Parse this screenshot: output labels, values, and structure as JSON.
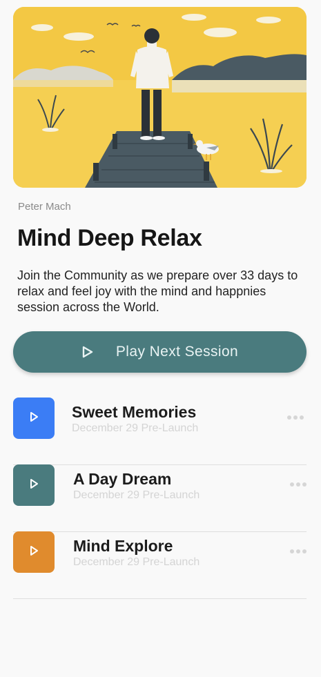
{
  "hero": {
    "image_name": "person-on-dock-illustration"
  },
  "author": "Peter Mach",
  "title": "Mind Deep Relax",
  "description": "Join the Community as we prepare over 33 days to relax and feel joy with the mind and happnies session across the World.",
  "play_button": {
    "label": "Play Next Session",
    "icon": "play-icon"
  },
  "sessions": [
    {
      "title": "Sweet Memories",
      "subtitle": "December 29 Pre-Launch",
      "color": "#3b7df5",
      "icon": "play-icon"
    },
    {
      "title": "A Day Dream",
      "subtitle": "December 29 Pre-Launch",
      "color": "#4a7b7e",
      "icon": "play-icon"
    },
    {
      "title": "Mind Explore",
      "subtitle": "December 29 Pre-Launch",
      "color": "#e08b2d",
      "icon": "play-icon"
    }
  ],
  "colors": {
    "accent": "#4a7b7e",
    "hero_bg": "#f3c844",
    "blue": "#3b7df5",
    "orange": "#e08b2d"
  }
}
